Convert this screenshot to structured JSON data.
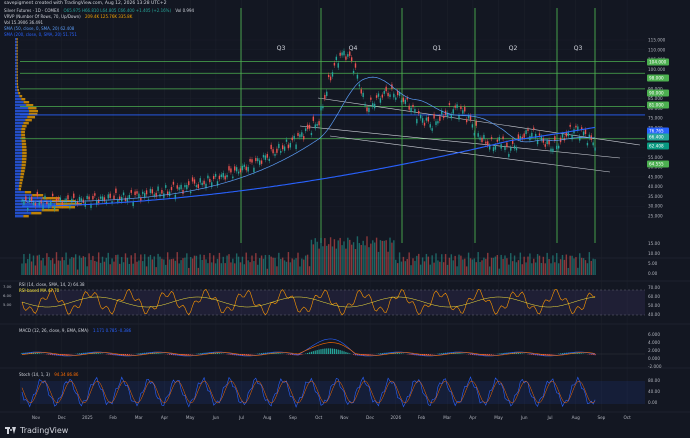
{
  "caption": "savepigment created with TradingView.com, Aug 12, 2026 13:28 UTC+2",
  "legend": {
    "symbol": "Silver Futures · 1D · COMEX",
    "ohlc": "O65.975 H66.810 L64.805 C66.400 +1.405 (+2.16%)",
    "vol_label": "Vol 0.994",
    "vrvp": "VRVP (Number Of Rows, 70, Up/Down)",
    "vrvp_vals": "209.4K 125.76K 335.8K",
    "volume": "Vol 15.3906 36.491",
    "sma1": "SMA (50, close, 0, SMA, 20) 62.408",
    "sma2": "SMA (200, close, 0, SMA, 20) 51.751"
  },
  "quarters": [
    "Q3",
    "Q4",
    "Q1",
    "Q2",
    "Q3"
  ],
  "price_axis": [
    "115.000",
    "110.000",
    "105.000",
    "100.000",
    "95.000",
    "90.000",
    "85.000",
    "80.000",
    "75.000",
    "70.000",
    "65.000",
    "60.000",
    "55.000",
    "50.000",
    "45.000",
    "40.000",
    "35.000",
    "30.000",
    "25.000"
  ],
  "price_badges": [
    {
      "label": "104.000",
      "color": "#4caf50"
    },
    {
      "label": "98.000",
      "color": "#4caf50"
    },
    {
      "label": "90.000",
      "color": "#4caf50"
    },
    {
      "label": "81.000",
      "color": "#4caf50"
    },
    {
      "label": "76.765",
      "color": "#2962ff"
    },
    {
      "label": "66.400",
      "color": "#26a69a"
    },
    {
      "label": "62.408",
      "color": "#089981"
    },
    {
      "label": "64.555",
      "color": "#4caf50"
    }
  ],
  "volume_axis": [
    "15.00",
    "10.00",
    "5.00",
    "0.00"
  ],
  "rsi_legend": "RSI (14, close, SMA, 14, 2) 64.38",
  "rsi_legend_value": "RSI-based MA 47.70",
  "rsi_axis": [
    "70.00",
    "60.00",
    "50.00",
    "40.00"
  ],
  "rsi_left": [
    "7.00",
    "6.00",
    "5.00"
  ],
  "macd_legend": "MACD (12, 26, close, 9, EMA, EMA)",
  "macd_values": "1.171 0.785 -0.386",
  "macd_axis": [
    "6.000",
    "4.000",
    "2.000",
    "0.000",
    "-2.000"
  ],
  "stoch_legend": "Stoch (14, 1, 3)",
  "stoch_values": "94.34 86.86",
  "stoch_axis": [
    "80.00",
    "40.00",
    "0.00"
  ],
  "time_axis": [
    "Nov",
    "Dec",
    "2025",
    "Feb",
    "Mar",
    "Apr",
    "May",
    "Jun",
    "Jul",
    "Aug",
    "Sep",
    "Oct",
    "Nov",
    "Dec",
    "2026",
    "Feb",
    "Mar",
    "Apr",
    "May",
    "Jun",
    "Jul",
    "Aug",
    "Sep",
    "Oct"
  ],
  "brand": "TradingView",
  "colors": {
    "background": "#131722",
    "up": "#26a69a",
    "down": "#ef5350",
    "quarter_line": "#4caf50",
    "sma50": "#5b9cf6",
    "sma200": "#2962ff",
    "rsi": "#ff9800",
    "stoch_k": "#2962ff",
    "stoch_d": "#ff6d00"
  }
}
